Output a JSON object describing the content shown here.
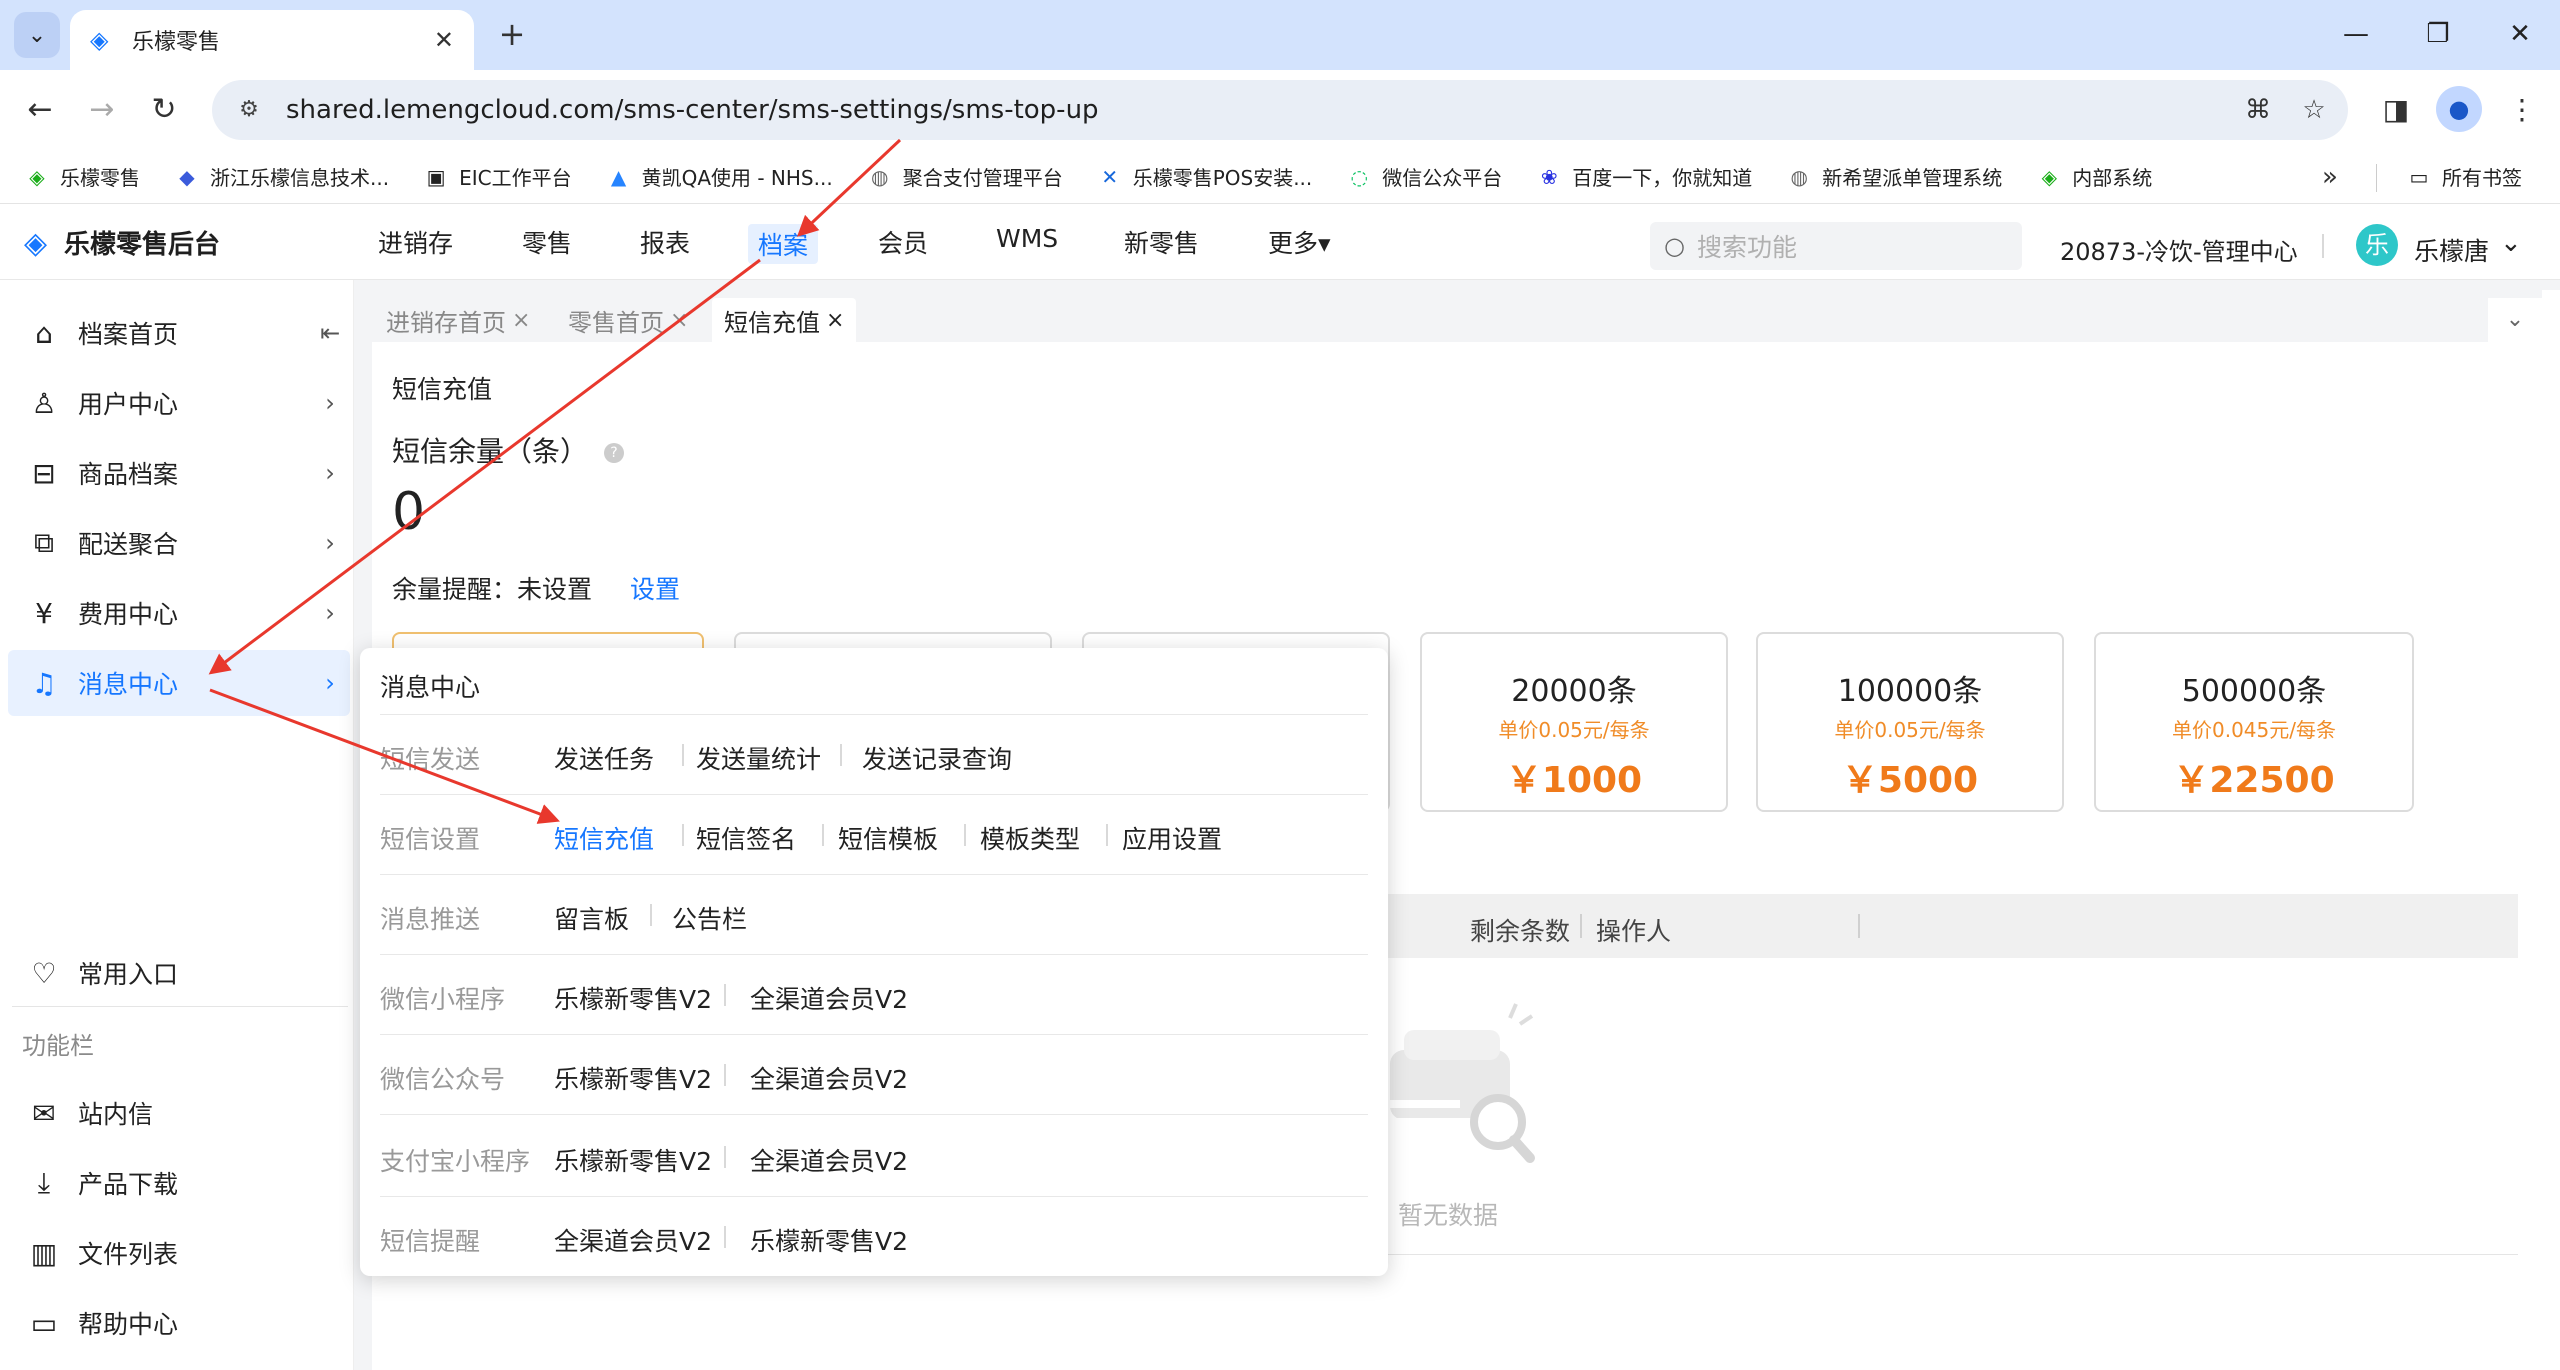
{
  "browser": {
    "tab_title": "乐檬零售",
    "url": "shared.lemengcloud.com/sms-center/sms-settings/sms-top-up",
    "bookmarks": [
      {
        "label": "乐檬零售",
        "icon": "lemeng-icon",
        "glyph": "◈",
        "color": "#1aad19"
      },
      {
        "label": "浙江乐檬信息技术...",
        "icon": "company-icon",
        "glyph": "◆",
        "color": "#3b5bdb"
      },
      {
        "label": "EIC工作平台",
        "icon": "eic-icon",
        "glyph": "▣",
        "color": "#222"
      },
      {
        "label": "黄凯QA使用 - NHS...",
        "icon": "jira-icon",
        "glyph": "▲",
        "color": "#2684ff"
      },
      {
        "label": "聚合支付管理平台",
        "icon": "globe-icon",
        "glyph": "◍",
        "color": "#666"
      },
      {
        "label": "乐檬零售POS安装...",
        "icon": "confluence-icon",
        "glyph": "✕",
        "color": "#1868db"
      },
      {
        "label": "微信公众平台",
        "icon": "wechat-icon",
        "glyph": "◌",
        "color": "#07c160"
      },
      {
        "label": "百度一下，你就知道",
        "icon": "baidu-icon",
        "glyph": "❀",
        "color": "#2932e1"
      },
      {
        "label": "新希望派单管理系统",
        "icon": "globe-icon",
        "glyph": "◍",
        "color": "#666"
      },
      {
        "label": "内部系统",
        "icon": "lemeng-icon",
        "glyph": "◈",
        "color": "#1aad19"
      }
    ],
    "all_bookmarks": "所有书签"
  },
  "header": {
    "logo_text": "乐檬零售后台",
    "nav": [
      "进销存",
      "零售",
      "报表",
      "档案",
      "会员",
      "WMS",
      "新零售",
      "更多▾"
    ],
    "active_nav": "档案",
    "search_placeholder": "搜索功能",
    "org": "20873-冷饮-管理中心",
    "user_avatar": "乐",
    "user_name": "乐檬唐"
  },
  "sidebar": {
    "items": [
      {
        "label": "档案首页",
        "icon": "home-icon"
      },
      {
        "label": "用户中心",
        "icon": "user-icon"
      },
      {
        "label": "商品档案",
        "icon": "product-icon"
      },
      {
        "label": "配送聚合",
        "icon": "delivery-icon"
      },
      {
        "label": "费用中心",
        "icon": "fee-icon"
      },
      {
        "label": "消息中心",
        "icon": "bell-icon"
      }
    ],
    "favorites": "常用入口",
    "section_title": "功能栏",
    "tools": [
      {
        "label": "站内信",
        "icon": "mail-icon"
      },
      {
        "label": "产品下载",
        "icon": "download-icon"
      },
      {
        "label": "文件列表",
        "icon": "chart-icon"
      },
      {
        "label": "帮助中心",
        "icon": "help-icon"
      }
    ]
  },
  "page_tabs": [
    {
      "label": "进销存首页",
      "active": false
    },
    {
      "label": "零售首页",
      "active": false
    },
    {
      "label": "短信充值",
      "active": true
    }
  ],
  "main": {
    "breadcrumb": "短信充值",
    "balance_label": "短信余量（条）",
    "balance_value": "0",
    "reminder_label": "余量提醒：未设置",
    "reminder_link": "设置",
    "packages": [
      {
        "qty": "20000条",
        "unit_price": "单价0.05元/每条",
        "price": "￥1000"
      },
      {
        "qty": "100000条",
        "unit_price": "单价0.05元/每条",
        "price": "￥5000"
      },
      {
        "qty": "500000条",
        "unit_price": "单价0.045元/每条",
        "price": "￥22500"
      }
    ],
    "table_headers": [
      "剩余条数",
      "操作人"
    ],
    "empty_text": "暂无数据"
  },
  "flyout": {
    "title": "消息中心",
    "rows": [
      {
        "label": "短信发送",
        "links": [
          "发送任务",
          "发送量统计",
          "发送记录查询"
        ]
      },
      {
        "label": "短信设置",
        "links": [
          "短信充值",
          "短信签名",
          "短信模板",
          "模板类型",
          "应用设置"
        ]
      },
      {
        "label": "消息推送",
        "links": [
          "留言板",
          "公告栏"
        ]
      },
      {
        "label": "微信小程序",
        "links": [
          "乐檬新零售V2",
          "全渠道会员V2"
        ]
      },
      {
        "label": "微信公众号",
        "links": [
          "乐檬新零售V2",
          "全渠道会员V2"
        ]
      },
      {
        "label": "支付宝小程序",
        "links": [
          "乐檬新零售V2",
          "全渠道会员V2"
        ]
      },
      {
        "label": "短信提醒",
        "links": [
          "全渠道会员V2",
          "乐檬新零售V2"
        ]
      }
    ],
    "active_link": "短信充值"
  },
  "colors": {
    "accent": "#1677ff",
    "price": "#f07a1a",
    "annotation": "#e8382d"
  }
}
